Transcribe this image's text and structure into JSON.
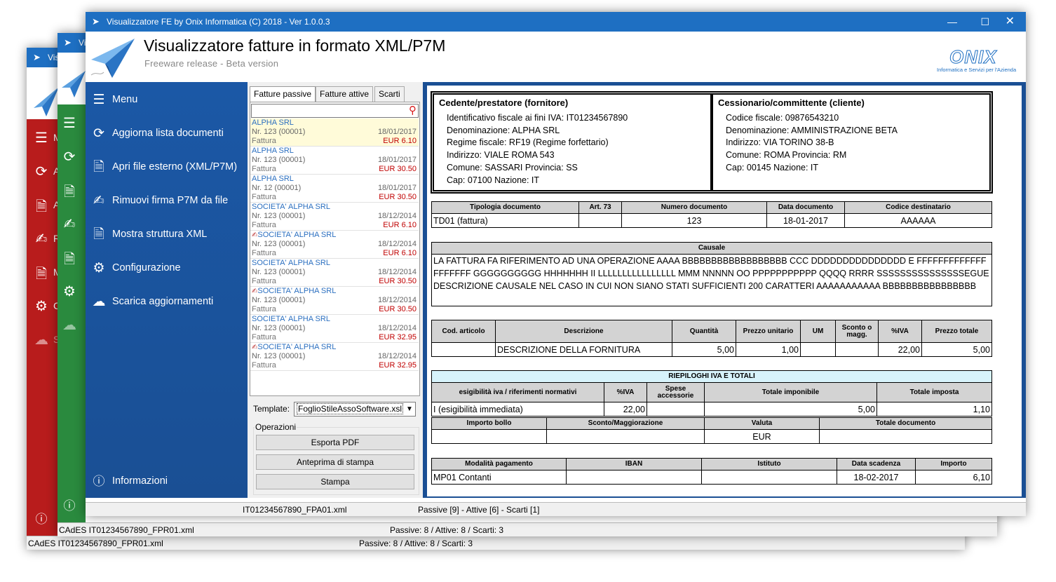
{
  "back_window_red": {
    "title": "Vis",
    "menu_label": "M",
    "items": [
      "A",
      "A",
      "R",
      "M",
      "C",
      "S"
    ],
    "status_file": "CAdES IT01234567890_FPR01.xml",
    "status_counts": "Passive: 8 / Attive: 8 / Scarti: 3",
    "color": "#b81c1c"
  },
  "back_window_green": {
    "title": "Vi",
    "items_icons": [
      "menu-icon",
      "refresh-icon",
      "document-icon",
      "signature-icon",
      "xml-file-icon",
      "gears-icon",
      "cloud-download-icon"
    ],
    "status_file": "CAdES IT01234567890_FPR01.xml",
    "status_counts": "Passive: 8 / Attive: 8 / Scarti: 3",
    "color": "#2a8a3e"
  },
  "app": {
    "title": "Visualizzatore FE by Onix Informatica (C) 2018 - Ver 1.0.0.3",
    "heading": "Visualizzatore fatture in formato XML/P7M",
    "subheading": "Freeware release - Beta version",
    "logo_text": "ONIX",
    "logo_tagline": "Informatica e Servizi per l'Azienda",
    "accent": "#1e6fc2",
    "sidebar_color": "#1c56a0"
  },
  "menu": {
    "title": "Menu",
    "items": [
      {
        "label": "Aggiorna lista documenti",
        "icon": "refresh-icon"
      },
      {
        "label": "Apri file esterno (XML/P7M)",
        "icon": "document-icon"
      },
      {
        "label": "Rimuovi firma P7M da file",
        "icon": "signature-icon"
      },
      {
        "label": "Mostra struttura XML",
        "icon": "xml-file-icon"
      },
      {
        "label": "Configurazione",
        "icon": "gears-icon"
      },
      {
        "label": "Scarica aggiornamenti",
        "icon": "cloud-download-icon"
      }
    ],
    "info": "Informazioni"
  },
  "tabs": [
    "Fatture passive",
    "Fatture attive",
    "Scarti"
  ],
  "search": {
    "value": "",
    "placeholder": ""
  },
  "documents": [
    {
      "name": "ALPHA SRL",
      "ref": "Nr. 123 (00001)",
      "date": "18/01/2017",
      "type": "Fattura",
      "amount": "EUR 6.10",
      "signed": false
    },
    {
      "name": "ALPHA SRL",
      "ref": "Nr. 123 (00001)",
      "date": "18/01/2017",
      "type": "Fattura",
      "amount": "EUR 30.50",
      "signed": false
    },
    {
      "name": "ALPHA SRL",
      "ref": "Nr. 12 (00001)",
      "date": "18/01/2017",
      "type": "Fattura",
      "amount": "EUR 30.50",
      "signed": false
    },
    {
      "name": "SOCIETA' ALPHA SRL",
      "ref": "Nr. 123 (00001)",
      "date": "18/12/2014",
      "type": "Fattura",
      "amount": "EUR 6.10",
      "signed": false
    },
    {
      "name": "SOCIETA' ALPHA SRL",
      "ref": "Nr. 123 (00001)",
      "date": "18/12/2014",
      "type": "Fattura",
      "amount": "EUR 6.10",
      "signed": true
    },
    {
      "name": "SOCIETA' ALPHA SRL",
      "ref": "Nr. 123 (00001)",
      "date": "18/12/2014",
      "type": "Fattura",
      "amount": "EUR 30.50",
      "signed": false
    },
    {
      "name": "SOCIETA' ALPHA SRL",
      "ref": "Nr. 123 (00001)",
      "date": "18/12/2014",
      "type": "Fattura",
      "amount": "EUR 30.50",
      "signed": true
    },
    {
      "name": "SOCIETA' ALPHA SRL",
      "ref": "Nr. 123 (00001)",
      "date": "18/12/2014",
      "type": "Fattura",
      "amount": "EUR 32.95",
      "signed": false
    },
    {
      "name": "SOCIETA' ALPHA SRL",
      "ref": "Nr. 123 (00001)",
      "date": "18/12/2014",
      "type": "Fattura",
      "amount": "EUR 32.95",
      "signed": true
    }
  ],
  "template": {
    "label": "Template:",
    "value": "FoglioStileAssoSoftware.xsl"
  },
  "operations": {
    "label": "Operazioni",
    "export_pdf": "Esporta PDF",
    "preview": "Anteprima di stampa",
    "print": "Stampa"
  },
  "status": {
    "file": "IT01234567890_FPA01.xml",
    "counts": "Passive [9] - Attive [6] - Scarti [1]"
  },
  "invoice": {
    "seller": {
      "title": "Cedente/prestatore (fornitore)",
      "lines": [
        "Identificativo fiscale ai fini IVA: IT01234567890",
        "Denominazione: ALPHA SRL",
        "Regime fiscale: RF19 (Regime forfettario)",
        "Indirizzo: VIALE ROMA 543",
        "Comune: SASSARI Provincia: SS",
        "Cap: 07100 Nazione: IT"
      ]
    },
    "buyer": {
      "title": "Cessionario/committente (cliente)",
      "lines": [
        "Codice fiscale: 09876543210",
        "Denominazione: AMMINISTRAZIONE BETA",
        "Indirizzo: VIA TORINO 38-B",
        "Comune: ROMA Provincia: RM",
        "Cap: 00145 Nazione: IT"
      ]
    },
    "doc_headers": [
      "Tipologia documento",
      "Art. 73",
      "Numero documento",
      "Data documento",
      "Codice destinatario"
    ],
    "doc_values": [
      "TD01 (fattura)",
      "",
      "123",
      "18-01-2017",
      "AAAAAA"
    ],
    "causale_header": "Causale",
    "causale_text": "LA FATTURA FA RIFERIMENTO AD UNA OPERAZIONE AAAA BBBBBBBBBBBBBBBBBB CCC DDDDDDDDDDDDDDD E FFFFFFFFFFFFFFFFFFFF GGGGGGGGGG HHHHHHH II LLLLLLLLLLLLLLLL MMM NNNNN OO PPPPPPPPPPP QQQQ RRRR SSSSSSSSSSSSSSSEGUE DESCRIZIONE CAUSALE NEL CASO IN CUI NON SIANO STATI SUFFICIENTI 200 CARATTERI AAAAAAAAAAA BBBBBBBBBBBBBBBB",
    "line_headers": [
      "Cod. articolo",
      "Descrizione",
      "Quantità",
      "Prezzo unitario",
      "UM",
      "Sconto o magg.",
      "%IVA",
      "Prezzo totale"
    ],
    "line_values": [
      "",
      "DESCRIZIONE DELLA FORNITURA",
      "5,00",
      "1,00",
      "",
      "",
      "22,00",
      "5,00"
    ],
    "summary_title": "RIEPILOGHI IVA E TOTALI",
    "summary_headers": [
      "esigibilità iva / riferimenti normativi",
      "%IVA",
      "Spese accessorie",
      "Totale imponibile",
      "Totale imposta"
    ],
    "summary_values": [
      "I (esigibilità immediata)",
      "22,00",
      "",
      "5,00",
      "1,10"
    ],
    "totals_headers": [
      "Importo bollo",
      "Sconto/Maggiorazione",
      "Valuta",
      "Totale documento"
    ],
    "totals_values": [
      "",
      "",
      "EUR",
      ""
    ],
    "payment_headers": [
      "Modalità pagamento",
      "IBAN",
      "Istituto",
      "Data scadenza",
      "Importo"
    ],
    "payment_values": [
      "MP01 Contanti",
      "",
      "",
      "18-02-2017",
      "6,10"
    ]
  }
}
